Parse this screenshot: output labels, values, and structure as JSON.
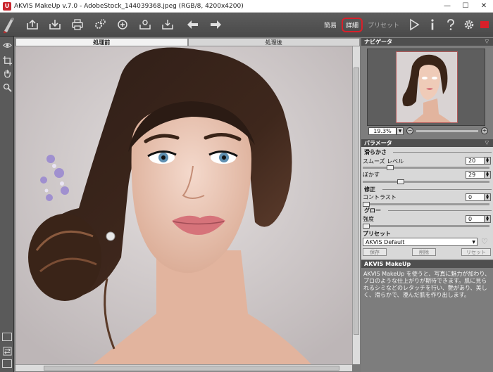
{
  "window": {
    "title": "AKVIS MakeUp v.7.0 - AdobeStock_144039368.jpeg (RGB/8, 4200x4200)",
    "minimize": "—",
    "maximize": "☐",
    "close": "✕"
  },
  "toolbar": {
    "left_icons": [
      "open-image-icon",
      "save-image-icon",
      "print-icon",
      "batch-processing-icon",
      "share-icon",
      "save-preset-icon",
      "load-preset-icon",
      "undo-arrow-icon",
      "redo-arrow-icon"
    ],
    "modes": {
      "simple": "簡易",
      "advanced": "詳細",
      "presets": "プリセット"
    },
    "right_icons": [
      "run-icon",
      "info-icon",
      "help-icon",
      "settings-icon",
      "flag-icon"
    ],
    "accent": "#d8202a"
  },
  "left_tools": [
    "eye-icon",
    "crop-icon",
    "hand-icon",
    "zoom-icon"
  ],
  "canvas": {
    "tab_before": "処理前",
    "tab_after": "処理後"
  },
  "navigator": {
    "title": "ナビゲータ",
    "zoom": "19.3%",
    "zoom_minus": "−",
    "zoom_plus": "+"
  },
  "params": {
    "title": "パラメータ",
    "smoothing": {
      "group": "滑らかさ",
      "smoothness_label": "スムーズ レベル",
      "smoothness_value": "20",
      "smoothness_level": 0.2,
      "blur_label": "ぼかす",
      "blur_value": "29",
      "blur_level": 0.29
    },
    "correction": {
      "group": "修正",
      "contrast_label": "コントラスト",
      "contrast_value": "0",
      "contrast_level": 0.0
    },
    "glow": {
      "group": "グロー",
      "strength_label": "強度",
      "strength_value": "0",
      "strength_level": 0.0
    },
    "preset": {
      "label": "プリセット",
      "selected": "AKVIS Default",
      "save": "保存",
      "delete": "削除",
      "reset": "リセット"
    }
  },
  "help": {
    "title": "AKVIS MakeUp",
    "text": "AKVIS MakeUp を使うと、写真に魅力が加わり、プロのような仕上がりが期待できます。肌に見られるシミなどのレタッチを行い、艶があり、美しく、滑らかで、澄んだ肌を作り出します。"
  }
}
